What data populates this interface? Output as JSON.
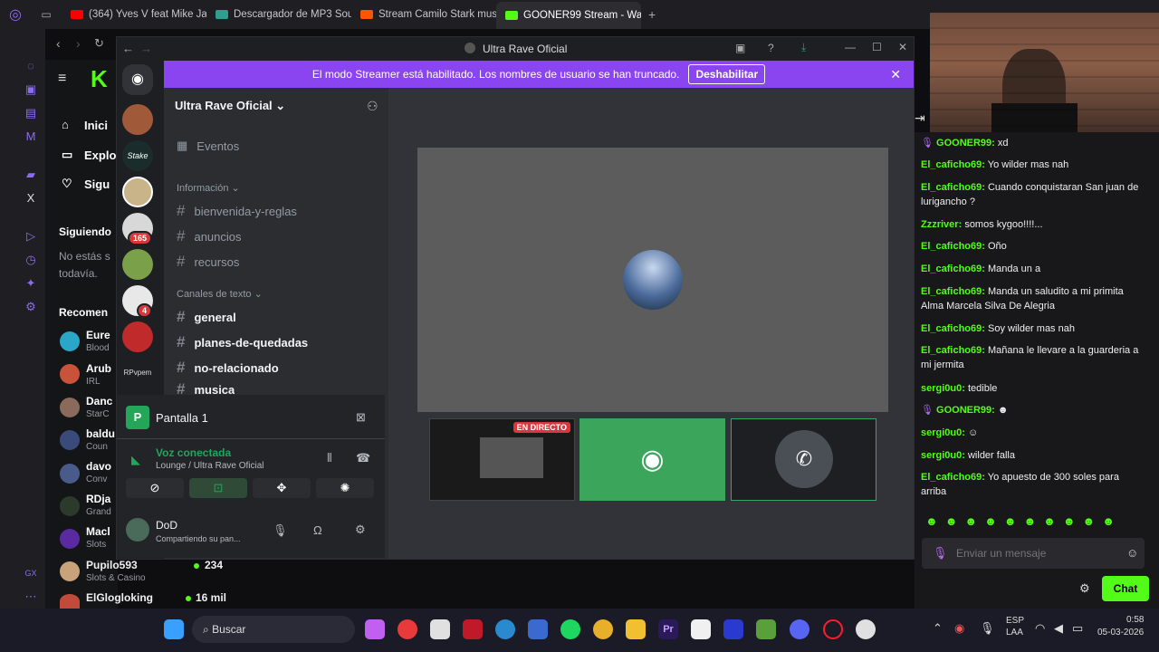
{
  "browser": {
    "tabs": [
      {
        "label": "(364) Yves V feat Mike Ja",
        "color": "#ff0000"
      },
      {
        "label": "Descargador de MP3 Sou",
        "color": "#2f9e8f"
      },
      {
        "label": "Stream Camilo Stark musi",
        "color": "#ff5500"
      },
      {
        "label": "GOONER99 Stream - Watc",
        "color": "#53fc18"
      }
    ],
    "new_tab": "+"
  },
  "kick": {
    "nav": [
      "Inici",
      "Explo",
      "Sigu"
    ],
    "following_title": "Siguiendo",
    "following_empty": "No estás s todavía.",
    "recommended_title": "Recomen",
    "channels": [
      {
        "name": "Eure",
        "sub": "Blood"
      },
      {
        "name": "Arub",
        "sub": "IRL"
      },
      {
        "name": "Danc",
        "sub": "StarC"
      },
      {
        "name": "baldu",
        "sub": "Coun"
      },
      {
        "name": "davo",
        "sub": "Conv"
      },
      {
        "name": "RDja",
        "sub": "Grand"
      },
      {
        "name": "Macl",
        "sub": "Slots"
      },
      {
        "name": "Pupilo593",
        "sub": "Slots & Casino",
        "viewers": "234"
      },
      {
        "name": "ElGlogloking",
        "sub": "",
        "viewers": "16 mil"
      }
    ]
  },
  "discord": {
    "window_title": "Ultra Rave Oficial",
    "streamer_banner": "El modo Streamer está habilitado. Los nombres de usuario se han truncado.",
    "streamer_button": "Deshabilitar",
    "server_name": "Ultra Rave Oficial",
    "events": "Eventos",
    "cat_info": "Información",
    "info_channels": [
      "bienvenida-y-reglas",
      "anuncios",
      "recursos"
    ],
    "cat_text": "Canales de texto",
    "text_channels": [
      "general",
      "planes-de-quedadas",
      "no-relacionado",
      "musica"
    ],
    "badges": [
      "165",
      "4"
    ],
    "server_text": [
      "Stake",
      "RPvpem"
    ],
    "screen_label": "Pantalla 1",
    "voice_status": "Voz conectada",
    "voice_channel": "Lounge / Ultra Rave Oficial",
    "user_name": "DoD",
    "user_status": "Compartiendo su pan...",
    "live_badge": "EN DIRECTO"
  },
  "chat": {
    "messages": [
      {
        "user": "GOONER99:",
        "text": "xd",
        "color": "#53fc18"
      },
      {
        "user": "El_caficho69:",
        "text": "Yo wilder mas nah",
        "color": "#53fc18"
      },
      {
        "user": "El_caficho69:",
        "text": "Cuando conquistaran San juan de lurigancho ?",
        "color": "#53fc18"
      },
      {
        "user": "Zzzriver:",
        "text": "somos kygoo!!!!...",
        "color": "#53fc18"
      },
      {
        "user": "El_caficho69:",
        "text": "Oño",
        "color": "#53fc18"
      },
      {
        "user": "El_caficho69:",
        "text": "Manda un a",
        "color": "#53fc18"
      },
      {
        "user": "El_caficho69:",
        "text": "Manda un saludito a mi primita Alma Marcela Silva De Alegria",
        "color": "#53fc18"
      },
      {
        "user": "El_caficho69:",
        "text": "Soy wilder mas nah",
        "color": "#53fc18"
      },
      {
        "user": "El_caficho69:",
        "text": "Mañana le llevare a la guarderia a mi jermita",
        "color": "#53fc18"
      },
      {
        "user": "sergi0u0:",
        "text": "tedible",
        "color": "#53fc18"
      },
      {
        "user": "GOONER99:",
        "text": "",
        "color": "#53fc18"
      },
      {
        "user": "sergi0u0:",
        "text": "",
        "color": "#53fc18"
      },
      {
        "user": "sergi0u0:",
        "text": "wilder falla",
        "color": "#53fc18"
      },
      {
        "user": "El_caficho69:",
        "text": "Yo apuesto de 300 soles para arriba",
        "color": "#53fc18"
      }
    ],
    "input_placeholder": "Enviar un mensaje",
    "send_label": "Chat"
  },
  "taskbar": {
    "search": "Buscar",
    "lang1": "ESP",
    "lang2": "LAA",
    "time": "0:58",
    "date": "05-03-2026"
  }
}
